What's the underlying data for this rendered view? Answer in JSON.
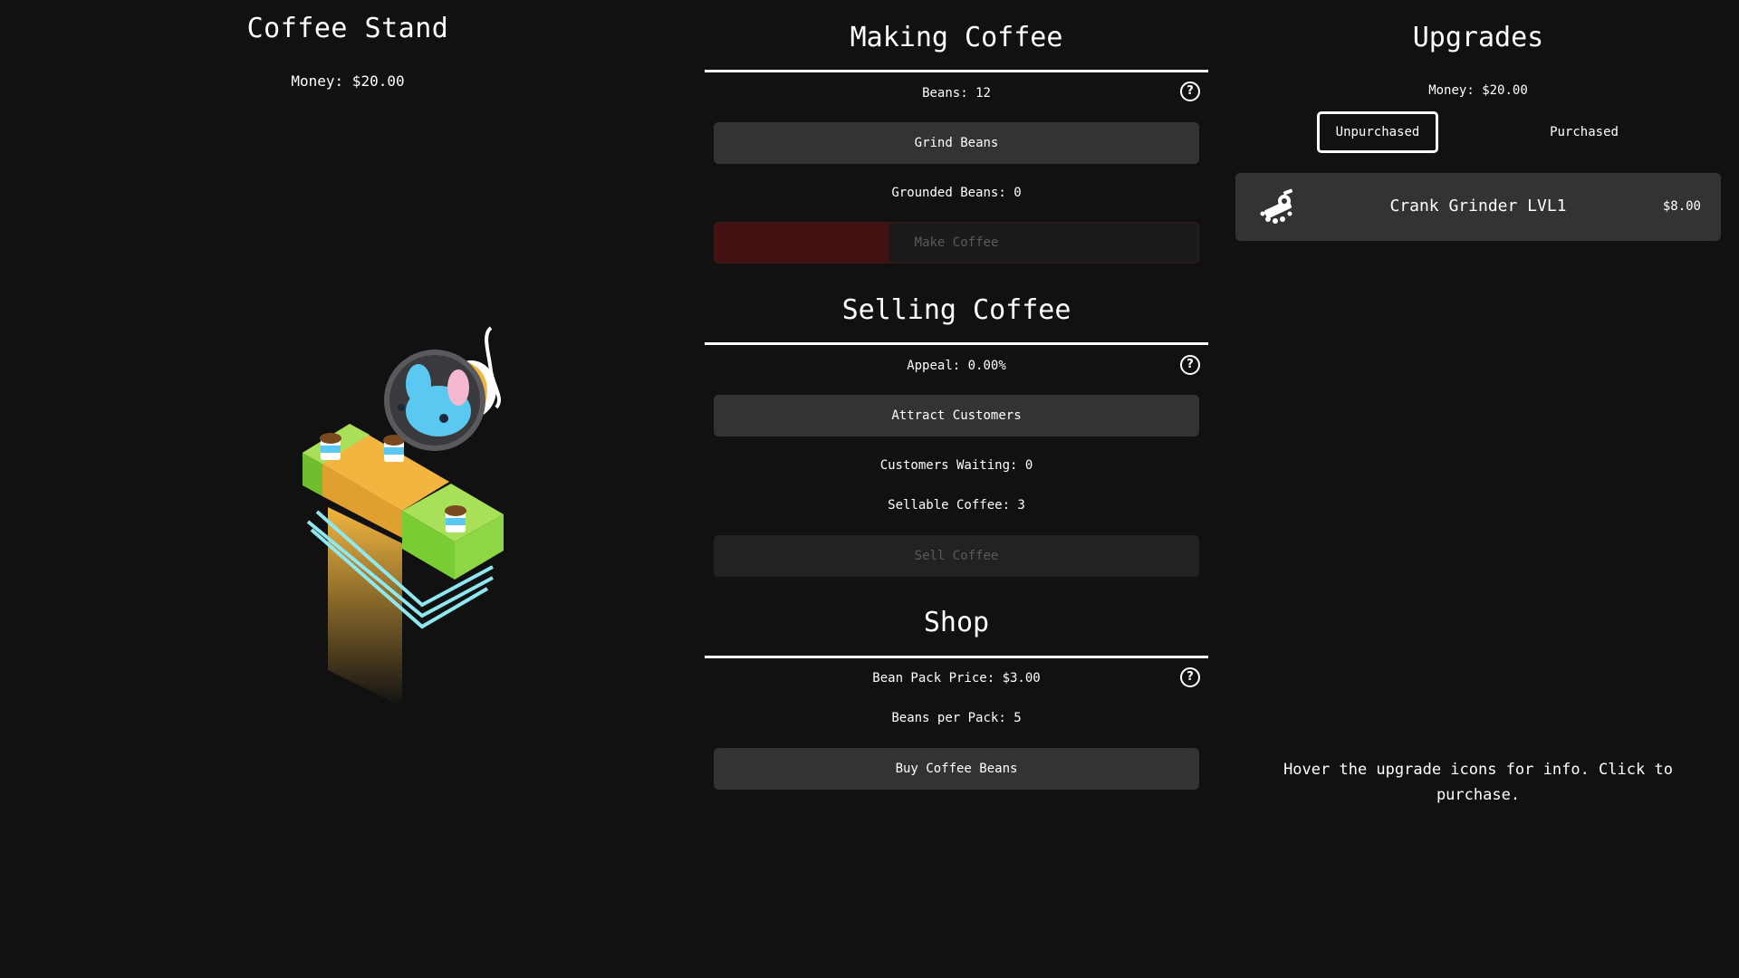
{
  "stand": {
    "title": "Coffee Stand",
    "money": "Money: $20.00"
  },
  "making": {
    "title": "Making Coffee",
    "beans": "Beans: 12",
    "grind_label": "Grind Beans",
    "grounded": "Grounded Beans: 0",
    "make_label": "Make Coffee",
    "make_progress": 0.36
  },
  "selling": {
    "title": "Selling Coffee",
    "appeal": "Appeal: 0.00%",
    "attract_label": "Attract Customers",
    "waiting": "Customers Waiting: 0",
    "sellable": "Sellable Coffee: 3",
    "sell_label": "Sell Coffee"
  },
  "shop": {
    "title": "Shop",
    "price": "Bean Pack Price: $3.00",
    "per_pack": "Beans per Pack: 5",
    "buy_label": "Buy Coffee Beans"
  },
  "upgrades": {
    "title": "Upgrades",
    "money": "Money: $20.00",
    "tabs": [
      "Unpurchased",
      "Purchased"
    ],
    "items": [
      {
        "name": "Crank Grinder LVL1",
        "price": "$8.00",
        "icon": "grinder-icon"
      }
    ],
    "hint": "Hover the upgrade icons for info. Click to purchase."
  },
  "help_glyph": "?",
  "colors": {
    "background": "#111112",
    "button": "#333334",
    "button_disabled": "#222223",
    "progress_fill": "#431313",
    "table_green": "#a8e05a",
    "table_yellow": "#f2b640",
    "neon_cyan": "#8fe8f0"
  }
}
